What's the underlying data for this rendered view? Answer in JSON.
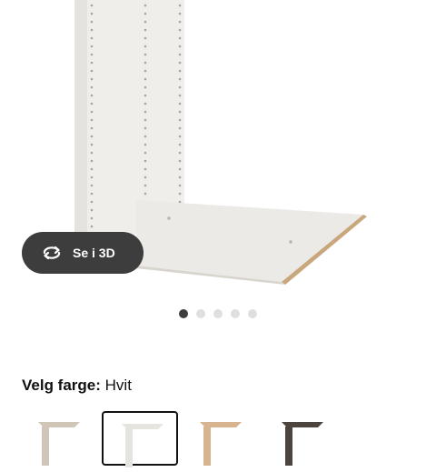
{
  "product": {
    "view_3d_label": "Se i 3D",
    "view_3d_icon": "rotate-3d-icon",
    "gallery": {
      "total_images": 5,
      "active_index": 0
    },
    "color_select": {
      "title": "Velg farge:",
      "value": "Hvit"
    },
    "color_options": [
      {
        "name": "swatch-beige",
        "color": "#cfc6b8",
        "selected": false
      },
      {
        "name": "swatch-white",
        "color": "#e6e4de",
        "selected": true
      },
      {
        "name": "swatch-oak",
        "color": "#d7b48f",
        "selected": false
      },
      {
        "name": "swatch-dark-brown",
        "color": "#4b443f",
        "selected": false
      }
    ]
  }
}
